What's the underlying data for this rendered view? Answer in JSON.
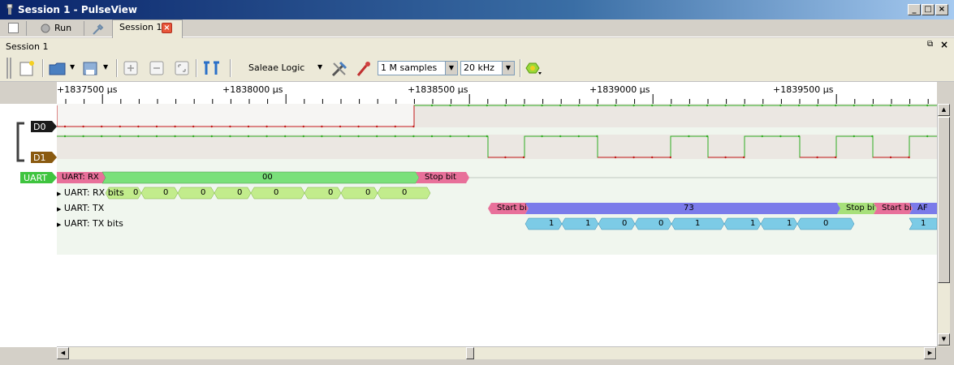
{
  "window": {
    "title": "Session 1 - PulseView"
  },
  "tabs": {
    "run_label": "Run",
    "session_tab_label": "Session 1"
  },
  "session_header": {
    "label": "Session 1"
  },
  "toolbar": {
    "device": "Saleae Logic",
    "samples": "1 M samples",
    "samplerate": "20 kHz"
  },
  "ruler": {
    "ticks": [
      "+1837500 µs",
      "+1838000 µs",
      "+1838500 µs",
      "+1839000 µs",
      "+1839500 µs"
    ]
  },
  "channels": {
    "d0": "D0",
    "d1": "D1",
    "uart": "UART"
  },
  "decoder_rows": {
    "rx": "UART: RX",
    "rx_bits": "UART: RX bits",
    "tx": "UART: TX",
    "tx_bits": "UART: TX bits"
  },
  "annotations": {
    "rx_byte": "00",
    "rx_stop": "Stop bit",
    "rx_bits": [
      "0",
      "0",
      "0",
      "0",
      "0",
      "0",
      "0",
      "0"
    ],
    "tx_start": "Start bit",
    "tx_byte": "73",
    "tx_stop": "Stop bit",
    "tx_start2": "Start bit",
    "tx_byte2": "AF",
    "tx_bits": [
      "1",
      "1",
      "0",
      "0",
      "1",
      "1",
      "1",
      "0"
    ],
    "tx_bits2_first": "1"
  },
  "colors": {
    "ruler_bg": "#ffffff",
    "signal_high": "#2fae22",
    "signal_low": "#c21818",
    "uart_green": "#3fc43f",
    "rx_data_fill": "#7ae07a",
    "rx_bits_fill": "#c2ec8c",
    "start_stop_fill": "#e8709a",
    "tx_byte_fill": "#7b7bea",
    "tx_bits_fill": "#7ccbe6",
    "tx_stop_fill": "#a7e07a"
  }
}
